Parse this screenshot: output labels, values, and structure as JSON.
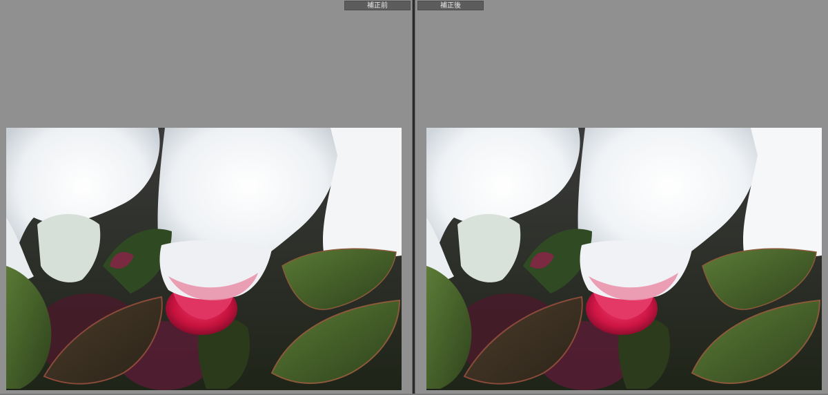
{
  "compare_view": {
    "before": {
      "label": "補正前",
      "image": "snow-covered-red-camellia-bud-before"
    },
    "after": {
      "label": "補正後",
      "image": "snow-covered-red-camellia-bud-after"
    }
  },
  "colors": {
    "workspace_bg": "#8f8f8f",
    "tab_bg": "#5c5c5c",
    "tab_text": "#e6e6e6",
    "divider": "#2a2a2a",
    "snow": "#f2f4f6",
    "leaf": "#3f5a2a",
    "bud": "#d61a4a"
  }
}
